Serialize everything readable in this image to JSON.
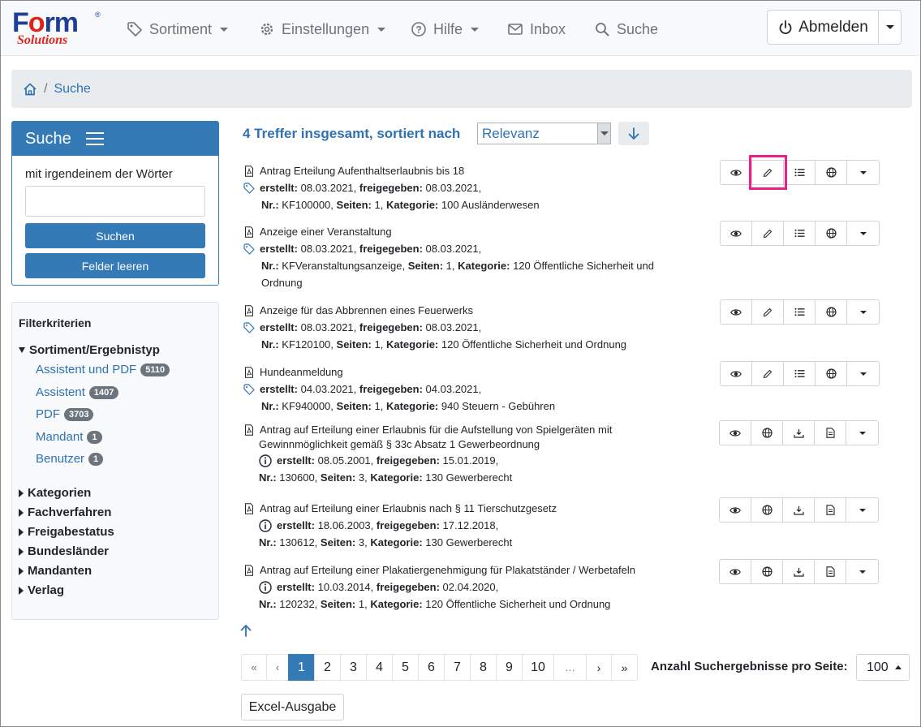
{
  "brand": {
    "logo_text_main": "Form",
    "logo_text_sub": "Solutions",
    "logo_reg": "®"
  },
  "nav": {
    "items": [
      {
        "label": "Sortiment",
        "icon": "tag-icon",
        "dropdown": true
      },
      {
        "label": "Einstellungen",
        "icon": "gear-icon",
        "dropdown": true
      },
      {
        "label": "Hilfe",
        "icon": "help-icon",
        "dropdown": true
      },
      {
        "label": "Inbox",
        "icon": "envelope-icon",
        "dropdown": false
      },
      {
        "label": "Suche",
        "icon": "search-icon",
        "dropdown": false
      }
    ],
    "logout_label": "Abmelden"
  },
  "breadcrumb": {
    "separator": "/",
    "current": "Suche"
  },
  "search_panel": {
    "title": "Suche",
    "field_label": "mit irgendeinem der Wörter",
    "input_value": "",
    "submit_label": "Suchen",
    "clear_label": "Felder leeren"
  },
  "filters": {
    "title": "Filterkriterien",
    "open_group": "Sortiment/Ergebnistyp",
    "facets": [
      {
        "label": "Assistent und PDF",
        "count": "5110"
      },
      {
        "label": "Assistent",
        "count": "1407"
      },
      {
        "label": "PDF",
        "count": "3703"
      },
      {
        "label": "Mandant",
        "count": "1"
      },
      {
        "label": "Benutzer",
        "count": "1"
      }
    ],
    "closed_groups": [
      "Kategorien",
      "Fachverfahren",
      "Freigabestatus",
      "Bundesländer",
      "Mandanten",
      "Verlag"
    ]
  },
  "results": {
    "summary": "4 Treffer insgesamt, sortiert nach",
    "sort_value": "Relevanz",
    "labels": {
      "created": "erstellt:",
      "released": "freigegeben:",
      "nr": "Nr.:",
      "pages": "Seiten:",
      "category": "Kategorie:"
    },
    "items": [
      {
        "title": "Antrag Erteilung Aufenthaltserlaubnis bis 18",
        "created": "08.03.2021,",
        "released": "08.03.2021,",
        "nr": "KF100000,",
        "pages": "1,",
        "category": "100 Ausländerwesen",
        "category_cont": ""
      },
      {
        "title": "Anzeige einer Veranstaltung",
        "created": "08.03.2021,",
        "released": "08.03.2021,",
        "nr": "KFVeranstaltungsanzeige,",
        "pages": "1,",
        "category": "120 Öffentliche Sicherheit und",
        "category_cont": "Ordnung"
      },
      {
        "title": "Anzeige für das Abbrennen eines Feuerwerks",
        "created": "08.03.2021,",
        "released": "08.03.2021,",
        "nr": "KF120100,",
        "pages": "1,",
        "category": "120 Öffentliche Sicherheit und Ordnung",
        "category_cont": ""
      },
      {
        "title": "Hundeanmeldung",
        "created": "04.03.2021,",
        "released": "04.03.2021,",
        "nr": "KF940000,",
        "pages": "1,",
        "category": "940 Steuern - Gebühren",
        "category_cont": ""
      },
      {
        "title": "Antrag auf Erteilung einer Erlaubnis für die Aufstellung von Spielgeräten mit",
        "title_cont": "Gewinnmöglichkeit gemäß § 33c Absatz 1 Gewerbeordnung",
        "created": "08.05.2001,",
        "released": "15.01.2019,",
        "nr": "130600,",
        "pages": "3,",
        "category": "130 Gewerberecht"
      },
      {
        "title": "Antrag auf Erteilung einer Erlaubnis nach § 11 Tierschutzgesetz",
        "created": "18.06.2003,",
        "released": "17.12.2018,",
        "nr": "130612,",
        "pages": "3,",
        "category": "130 Gewerberecht"
      },
      {
        "title": "Antrag auf Erteilung einer Plakatiergenehmigung für Plakatständer / Werbetafeln",
        "created": "10.03.2014,",
        "released": "02.04.2020,",
        "nr": "120232,",
        "pages": "1,",
        "category": "120 Öffentliche Sicherheit und Ordnung"
      }
    ]
  },
  "pagination": {
    "first": "«",
    "prev": "‹",
    "pages": [
      "1",
      "2",
      "3",
      "4",
      "5",
      "6",
      "7",
      "8",
      "9",
      "10"
    ],
    "ellipsis": "…",
    "next": "›",
    "last": "»",
    "active_page": "1"
  },
  "per_page": {
    "label": "Anzahl Suchergebnisse pro Seite:",
    "value": "100"
  },
  "excel_label": "Excel-Ausgabe",
  "colors": {
    "primary": "#337ab7",
    "link": "#2f72b3",
    "highlight": "#ec1e8c",
    "logo_blue": "#1d3f96",
    "logo_red": "#e2231a"
  }
}
